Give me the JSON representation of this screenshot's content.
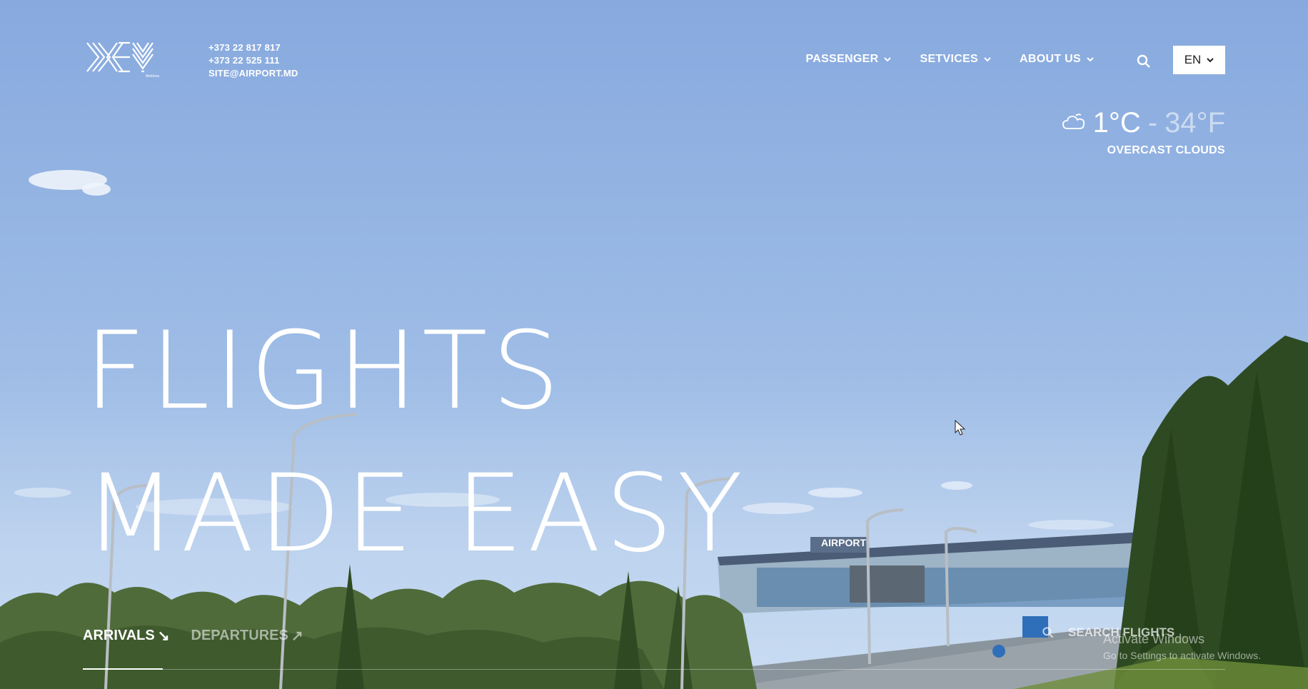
{
  "header": {
    "logo_icon": "kiv-airport-logo",
    "contacts": {
      "phone1": "+373 22 817 817",
      "phone2": "+373 22 525 111",
      "email": "SITE@AIRPORT.MD"
    },
    "nav": [
      {
        "label": "PASSENGER"
      },
      {
        "label": "SETVICES"
      },
      {
        "label": "ABOUT US"
      }
    ],
    "search_icon": "search-icon",
    "language": "EN"
  },
  "weather": {
    "icon": "cloud-icon",
    "temp_c": "1°C",
    "separator": "-",
    "temp_f": "34°F",
    "condition": "OVERCAST CLOUDS"
  },
  "hero": {
    "line1": "FLIGHTS",
    "line2": "MADE EASY"
  },
  "tabs": [
    {
      "label": "ARRIVALS",
      "arrow": "↘",
      "active": true
    },
    {
      "label": "DEPARTURES",
      "arrow": "↗",
      "active": false
    }
  ],
  "flight_search": {
    "label": "SEARCH FLIGHTS"
  },
  "watermark": {
    "title": "Activate Windows",
    "subtitle": "Go to Settings to activate Windows."
  },
  "billboard_sign": "AIRPORT"
}
